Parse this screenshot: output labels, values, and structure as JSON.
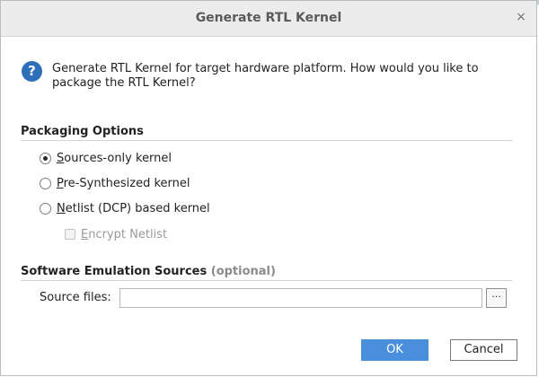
{
  "window": {
    "title": "Generate RTL Kernel",
    "close_glyph": "×"
  },
  "message": {
    "icon": "question-icon",
    "icon_glyph": "?",
    "text": "Generate RTL Kernel for target hardware platform. How would you like to package the RTL Kernel?"
  },
  "packaging": {
    "title": "Packaging Options",
    "options": [
      {
        "mnemonic": "S",
        "rest": "ources-only kernel",
        "selected": true
      },
      {
        "mnemonic": "P",
        "rest": "re-Synthesized kernel",
        "selected": false
      },
      {
        "mnemonic": "N",
        "rest": "etlist (DCP) based kernel",
        "selected": false
      }
    ],
    "encrypt": {
      "mnemonic": "E",
      "rest": "ncrypt Netlist",
      "checked": false,
      "enabled": false
    }
  },
  "emulation": {
    "title": "Software Emulation Sources",
    "title_suffix": "(optional)",
    "source_label": "Source files:",
    "source_value": "",
    "browse_label": "···"
  },
  "buttons": {
    "ok": "OK",
    "cancel": "Cancel"
  },
  "colors": {
    "accent": "#4a8fdb",
    "icon_blue": "#2d6fb8",
    "disabled_text": "#9a9a9a"
  }
}
